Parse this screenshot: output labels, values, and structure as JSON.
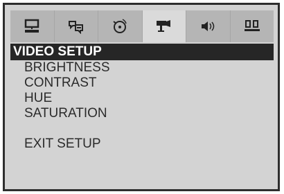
{
  "icon_bar": {
    "tabs": [
      {
        "icon": "monitor-icon",
        "active": false
      },
      {
        "icon": "language-icon",
        "active": false
      },
      {
        "icon": "audio-disc-icon",
        "active": false
      },
      {
        "icon": "video-camera-icon",
        "active": true
      },
      {
        "icon": "speaker-icon",
        "active": false
      },
      {
        "icon": "speaker-setup-icon",
        "active": false
      }
    ]
  },
  "menu": {
    "title": "VIDEO SETUP",
    "items": [
      "BRIGHTNESS",
      "CONTRAST",
      "HUE",
      "SATURATION"
    ],
    "exit_label": "EXIT SETUP"
  },
  "colors": {
    "frame": "#2e2e2e",
    "panel": "#d3d3d3",
    "icon_bar": "#b5b5b5",
    "active_tab": "#dadada",
    "title_bar": "#262626",
    "text": "#2b2b2b"
  }
}
